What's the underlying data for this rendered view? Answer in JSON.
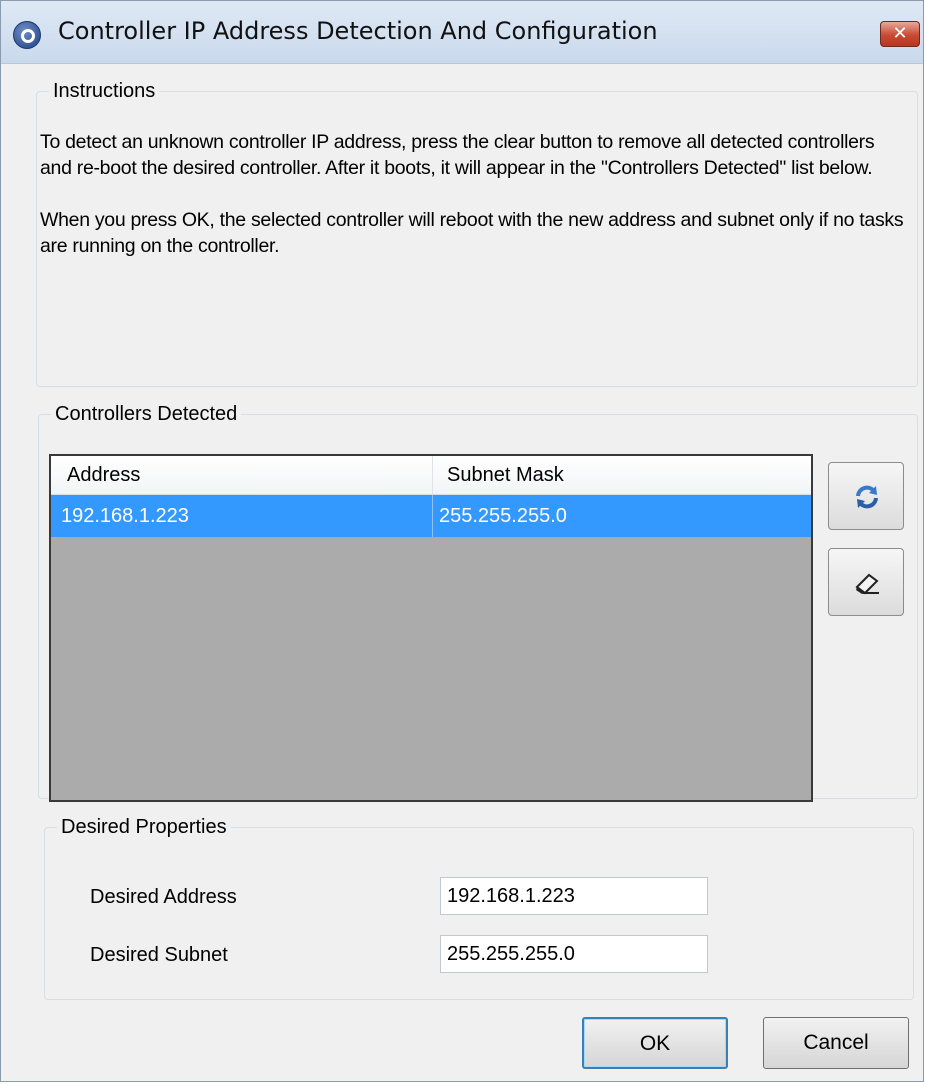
{
  "window": {
    "title": "Controller IP Address Detection And Configuration",
    "close_label": "✕"
  },
  "instructions": {
    "legend": "Instructions",
    "paragraph1": "To detect an unknown controller IP address, press the clear button to remove all detected controllers and re-boot the desired controller. After it boots, it will appear in the \"Controllers Detected\" list below.",
    "paragraph2": "When you press OK, the selected controller will reboot with the new address and subnet only if no tasks are running on the controller."
  },
  "controllers": {
    "legend": "Controllers Detected",
    "columns": [
      "Address",
      "Subnet Mask"
    ],
    "rows": [
      {
        "address": "192.168.1.223",
        "subnet": "255.255.255.0",
        "selected": true
      }
    ],
    "refresh_icon": "refresh-icon",
    "clear_icon": "eraser-icon"
  },
  "desired": {
    "legend": "Desired Properties",
    "address_label": "Desired Address",
    "address_value": "192.168.1.223",
    "subnet_label": "Desired Subnet",
    "subnet_value": "255.255.255.0"
  },
  "buttons": {
    "ok": "OK",
    "cancel": "Cancel"
  },
  "colors": {
    "selection": "#3399ff",
    "list_background": "#ababab",
    "dialog_background": "#f0f0f0"
  }
}
